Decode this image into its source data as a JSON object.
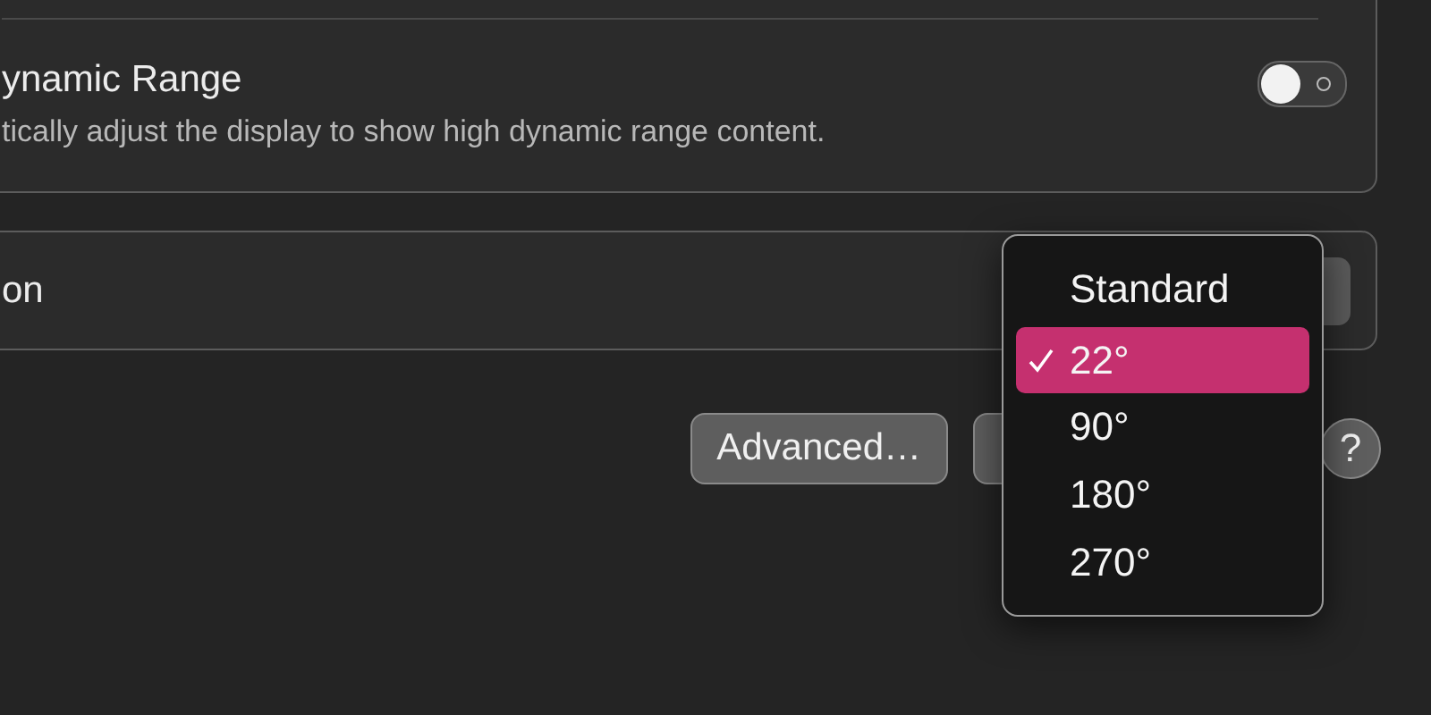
{
  "hdr_panel": {
    "title": "ynamic Range",
    "description": "tically adjust the display to show high dynamic range content.",
    "toggle": {
      "on": false
    }
  },
  "rotation_row": {
    "label": "on"
  },
  "buttons": [
    {
      "label": "Advanced…"
    }
  ],
  "help_button": {
    "label": "?"
  },
  "menu": {
    "items": [
      {
        "label": "Standard",
        "selected": false
      },
      {
        "label": "22°",
        "selected": true
      },
      {
        "label": "90°",
        "selected": false
      },
      {
        "label": "180°",
        "selected": false
      },
      {
        "label": "270°",
        "selected": false
      }
    ]
  }
}
